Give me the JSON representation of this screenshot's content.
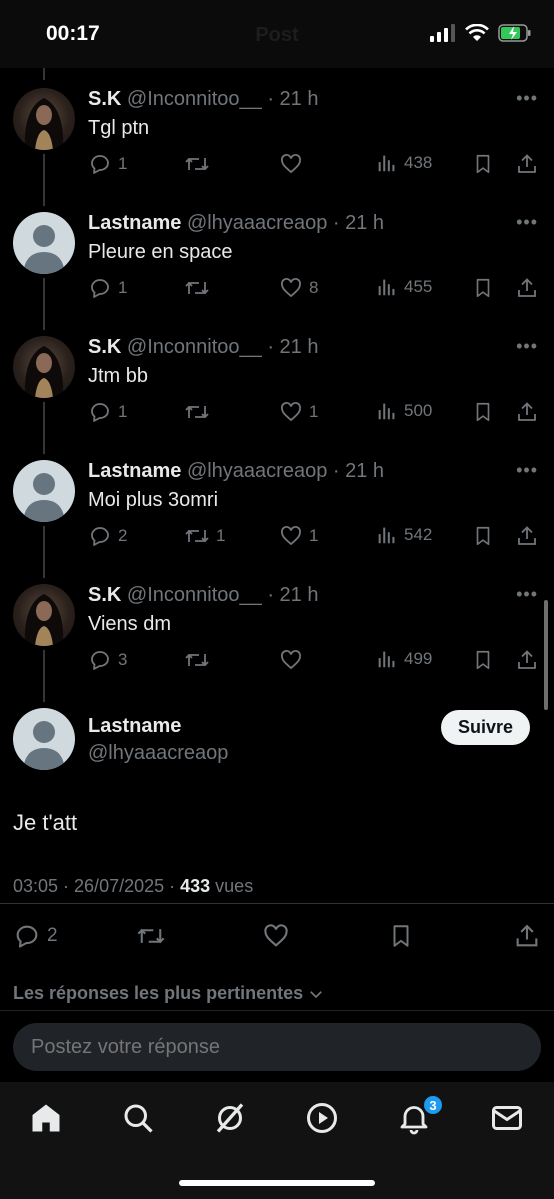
{
  "status": {
    "time": "00:17",
    "title": "Post"
  },
  "thread": [
    {
      "name": "S.K",
      "handle": "@Inconnitoo__",
      "time": "· 21 h",
      "text": "Tgl ptn",
      "avatar": "photo",
      "replies": "1",
      "reposts": "",
      "likes": "",
      "views": "438"
    },
    {
      "name": "Lastname",
      "handle": "@lhyaaacreaop",
      "time": "· 21 h",
      "text": "Pleure en space",
      "avatar": "default",
      "replies": "1",
      "reposts": "",
      "likes": "8",
      "views": "455"
    },
    {
      "name": "S.K",
      "handle": "@Inconnitoo__",
      "time": "· 21 h",
      "text": "Jtm bb",
      "avatar": "photo",
      "replies": "1",
      "reposts": "",
      "likes": "1",
      "views": "500"
    },
    {
      "name": "Lastname",
      "handle": "@lhyaaacreaop",
      "time": "· 21 h",
      "text": "Moi plus 3omri",
      "avatar": "default",
      "replies": "2",
      "reposts": "1",
      "likes": "1",
      "views": "542"
    },
    {
      "name": "S.K",
      "handle": "@Inconnitoo__",
      "time": "· 21 h",
      "text": "Viens dm",
      "avatar": "photo",
      "replies": "3",
      "reposts": "",
      "likes": "",
      "views": "499"
    }
  ],
  "main": {
    "name": "Lastname",
    "handle": "@lhyaaacreaop",
    "follow_label": "Suivre",
    "text": "Je t'att",
    "datetime": "03:05 · 26/07/2025 · ",
    "views_count": "433",
    "views_label": " vues",
    "replies": "2"
  },
  "sort_label": "Les réponses les plus pertinentes",
  "reply_placeholder": "Postez votre réponse",
  "notifications_badge": "3",
  "colors": {
    "accent": "#1d9bf0",
    "muted": "#71767b",
    "text": "#e7e9ea",
    "background": "#000000"
  }
}
